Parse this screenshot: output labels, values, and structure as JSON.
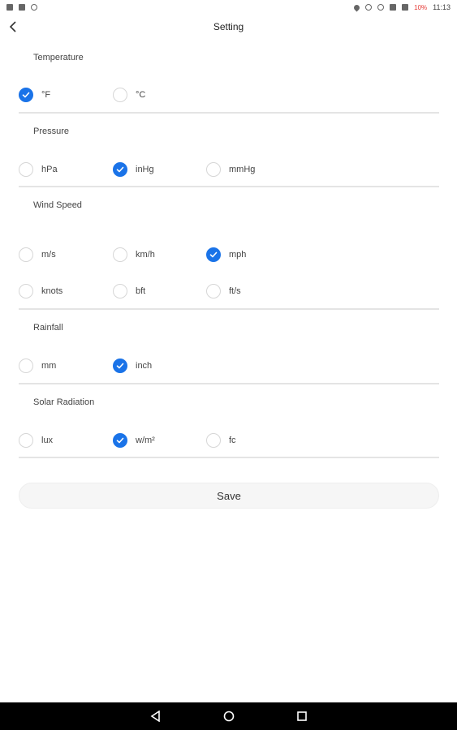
{
  "status_bar": {
    "battery": "10%",
    "time": "11:13",
    "icons_left": [
      "notification-icon",
      "sim-icon",
      "wifi-calling-icon"
    ],
    "icons_right": [
      "location-icon",
      "vibrate-icon",
      "alarm-icon",
      "wifi-icon",
      "signal-icon",
      "battery-icon"
    ]
  },
  "header": {
    "title": "Setting"
  },
  "sections": [
    {
      "title": "Temperature",
      "options": [
        {
          "label": "°F",
          "checked": true
        },
        {
          "label": "°C",
          "checked": false
        }
      ]
    },
    {
      "title": "Pressure",
      "options": [
        {
          "label": "hPa",
          "checked": false
        },
        {
          "label": "inHg",
          "checked": true
        },
        {
          "label": "mmHg",
          "checked": false
        }
      ]
    },
    {
      "title": "Wind Speed",
      "options": [
        {
          "label": "m/s",
          "checked": false
        },
        {
          "label": "km/h",
          "checked": false
        },
        {
          "label": "mph",
          "checked": true
        },
        {
          "label": "knots",
          "checked": false
        },
        {
          "label": "bft",
          "checked": false
        },
        {
          "label": "ft/s",
          "checked": false
        }
      ]
    },
    {
      "title": "Rainfall",
      "options": [
        {
          "label": "mm",
          "checked": false
        },
        {
          "label": "inch",
          "checked": true
        }
      ]
    },
    {
      "title": "Solar Radiation",
      "options": [
        {
          "label": "lux",
          "checked": false
        },
        {
          "label": "w/m²",
          "checked": true
        },
        {
          "label": "fc",
          "checked": false
        }
      ]
    }
  ],
  "save_label": "Save",
  "colors": {
    "accent": "#1a73e8",
    "divider": "#e4e4e4",
    "nav_bar": "#000000"
  },
  "nav_bar": [
    "back-triangle-icon",
    "home-circle-icon",
    "recents-square-icon"
  ]
}
